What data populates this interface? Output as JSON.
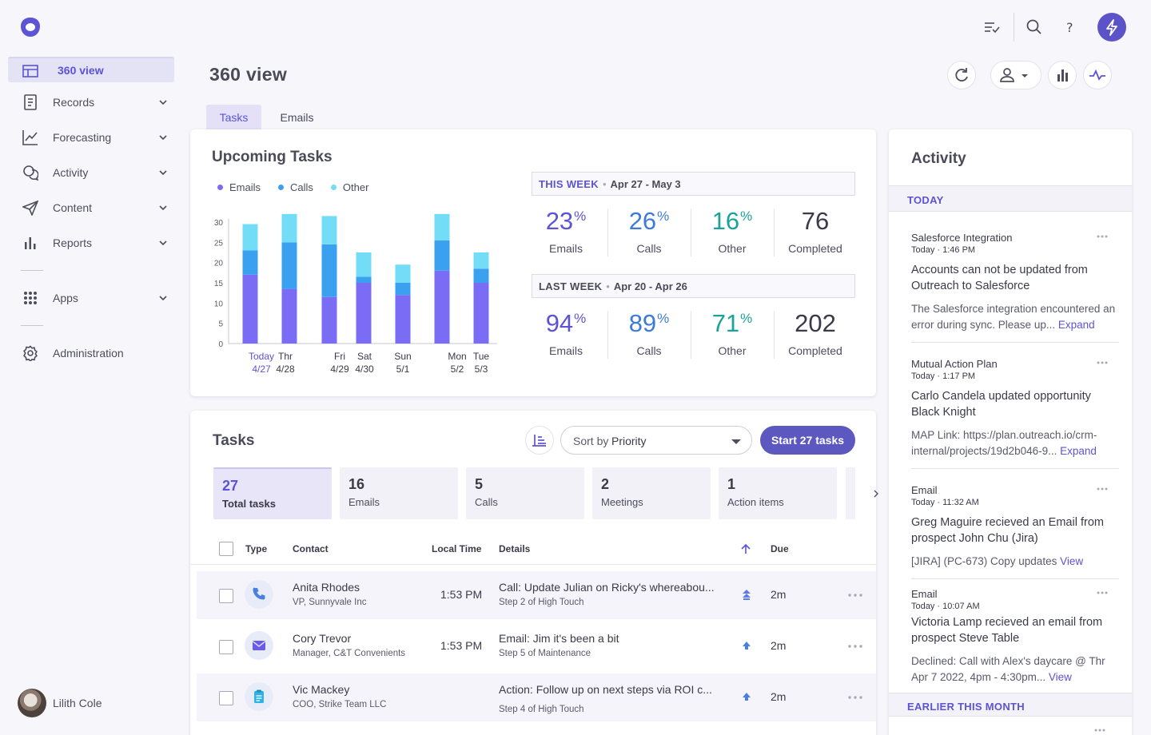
{
  "sidebar": {
    "items": [
      {
        "label": "360 view",
        "icon": "layout-icon",
        "active": true
      },
      {
        "label": "Records",
        "icon": "records-icon"
      },
      {
        "label": "Forecasting",
        "icon": "trend-icon"
      },
      {
        "label": "Activity",
        "icon": "chat-icon"
      },
      {
        "label": "Content",
        "icon": "send-icon"
      },
      {
        "label": "Reports",
        "icon": "bar-chart-icon"
      },
      {
        "label": "Apps",
        "icon": "grid-icon"
      },
      {
        "label": "Administration",
        "icon": "gear-icon"
      }
    ],
    "user": "Lilith Cole"
  },
  "header": {
    "title": "360 view"
  },
  "tabs": [
    {
      "label": "Tasks",
      "active": true
    },
    {
      "label": "Emails"
    }
  ],
  "upcoming": {
    "title": "Upcoming Tasks",
    "legend": [
      "Emails",
      "Calls",
      "Other"
    ],
    "this_week": {
      "label": "THIS WEEK",
      "range": "Apr 27 - May 3",
      "stats": [
        {
          "value": "23",
          "unit": "%",
          "label": "Emails",
          "color": "#5c53d6"
        },
        {
          "value": "26",
          "unit": "%",
          "label": "Calls",
          "color": "#3d7bd9"
        },
        {
          "value": "16",
          "unit": "%",
          "label": "Other",
          "color": "#1aa39a"
        },
        {
          "value": "76",
          "unit": "",
          "label": "Completed",
          "color": "#3a3a48"
        }
      ]
    },
    "last_week": {
      "label": "LAST WEEK",
      "range": "Apr 20 - Apr 26",
      "stats": [
        {
          "value": "94",
          "unit": "%",
          "label": "Emails",
          "color": "#5c53d6"
        },
        {
          "value": "89",
          "unit": "%",
          "label": "Calls",
          "color": "#3d7bd9"
        },
        {
          "value": "71",
          "unit": "%",
          "label": "Other",
          "color": "#1aa39a"
        },
        {
          "value": "202",
          "unit": "",
          "label": "Completed",
          "color": "#3a3a48"
        }
      ]
    }
  },
  "chart_data": {
    "type": "bar",
    "stacked": true,
    "ylim": [
      0,
      30
    ],
    "yticks": [
      "30",
      "25",
      "20",
      "15",
      "10",
      "5",
      "0"
    ],
    "x_labels": [
      {
        "day": "Today",
        "date": "4/27",
        "highlight": true
      },
      {
        "day": "Thr",
        "date": "4/28"
      },
      {
        "day": "Fri",
        "date": "4/29"
      },
      {
        "day": "Sat",
        "date": "4/30"
      },
      {
        "day": "Sun",
        "date": "5/1"
      },
      {
        "day": "Mon",
        "date": "5/2"
      },
      {
        "day": "Tue",
        "date": "5/3"
      }
    ],
    "series": [
      {
        "name": "Emails",
        "color": "#7b6cf6",
        "values": [
          17,
          13.5,
          11.5,
          15,
          12,
          18,
          15
        ]
      },
      {
        "name": "Calls",
        "color": "#3aa1f0",
        "values": [
          6,
          11.5,
          13,
          1.5,
          3,
          7.5,
          3.5
        ]
      },
      {
        "name": "Other",
        "color": "#73dcf7",
        "values": [
          6.5,
          7,
          7,
          6,
          4.5,
          6.5,
          4
        ]
      }
    ],
    "bar_days": [
      0,
      1,
      2,
      3,
      4,
      5,
      6
    ]
  },
  "tasks": {
    "title": "Tasks",
    "sort_label": "Sort by",
    "sort_value": "Priority",
    "start_label": "Start 27 tasks",
    "summary": [
      {
        "count": "27",
        "label": "Total tasks",
        "active": true
      },
      {
        "count": "16",
        "label": "Emails"
      },
      {
        "count": "5",
        "label": "Calls"
      },
      {
        "count": "2",
        "label": "Meetings"
      },
      {
        "count": "1",
        "label": "Action items"
      }
    ],
    "columns": {
      "type": "Type",
      "contact": "Contact",
      "time": "Local Time",
      "details": "Details",
      "due": "Due"
    },
    "rows": [
      {
        "type": "phone-icon",
        "name": "Anita Rhodes",
        "title": "VP, Sunnyvale Inc",
        "time": "1:53 PM",
        "detail": "Call: Update Julian on Ricky's whereabou...",
        "step": "Step 2 of High Touch",
        "due": "2m"
      },
      {
        "type": "mail-icon",
        "name": "Cory Trevor",
        "title": "Manager, C&T Convenients",
        "time": "1:53 PM",
        "detail": "Email: Jim it's been a bit",
        "step": "Step 5 of Maintenance",
        "due": "2m"
      },
      {
        "type": "clipboard-icon",
        "name": "Vic Mackey",
        "title": "COO, Strike Team LLC",
        "time": "",
        "detail": "Action: Follow up on next steps via ROI c...",
        "step": "Step 4 of High Touch",
        "due": "2m"
      }
    ]
  },
  "activity": {
    "title": "Activity",
    "today_label": "TODAY",
    "earlier_label": "EARLIER THIS MONTH",
    "items": [
      {
        "source": "Salesforce Integration",
        "when": "Today · 1:46 PM",
        "head": "Accounts can not be updated from Outreach to Salesforce",
        "body": "The Salesforce integration encountered an error during sync. Please up...",
        "link": "Expand"
      },
      {
        "source": "Mutual Action Plan",
        "when": "Today · 1:17 PM",
        "head": "Carlo Candela updated opportunity Black Knight",
        "body": "MAP Link: https://plan.outreach.io/crm-internal/projects/19d2b046-9...",
        "link": "Expand"
      },
      {
        "source": "Email",
        "when": "Today · 11:32 AM",
        "head": "Greg Maguire recieved an Email from prospect John Chu (Jira)",
        "body": "[JIRA] (PC-673) Copy updates",
        "link": "View"
      },
      {
        "source": "Email",
        "when": "Today · 10:07 AM",
        "head": "Victoria Lamp recieved an email from prospect Steve Table",
        "body": "Declined: Call with Alex's daycare @ Thr Apr 7 2022, 4pm - 4:30pm...",
        "link": "View"
      }
    ]
  }
}
